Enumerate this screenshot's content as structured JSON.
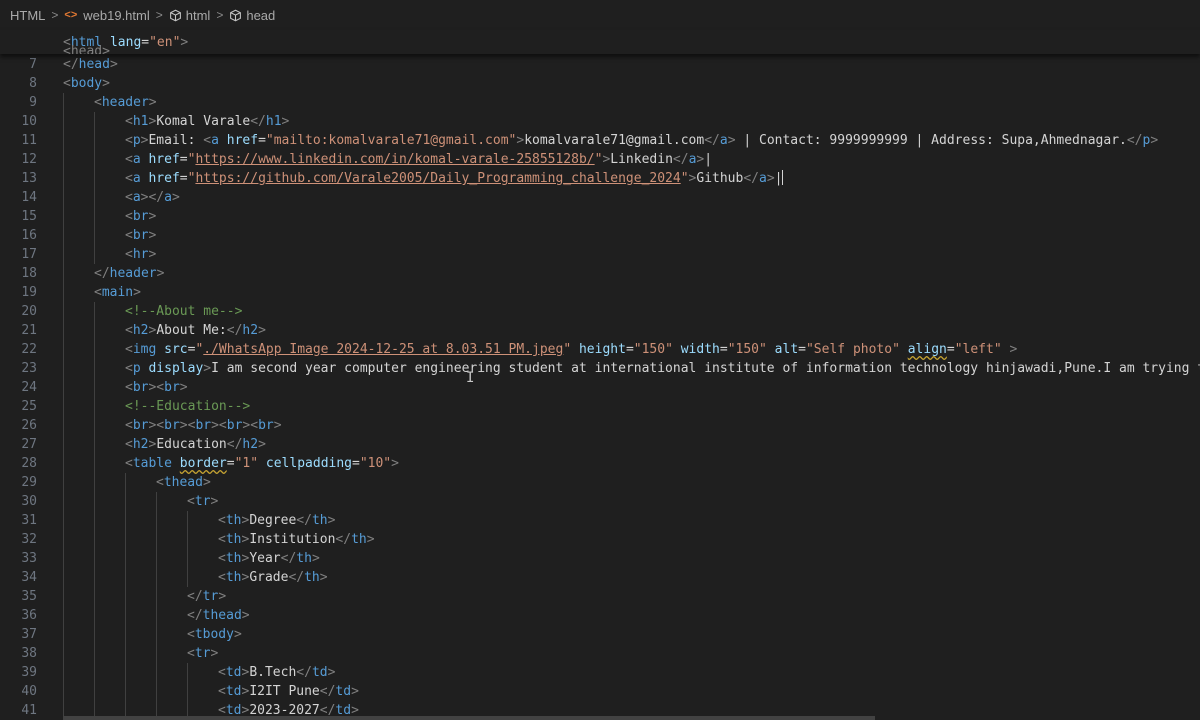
{
  "breadcrumb": {
    "root": "HTML",
    "file": "web19.html",
    "file_icon": "<>",
    "node1": "html",
    "node2": "head",
    "separator": ">"
  },
  "sticky": {
    "line_number": "2",
    "code": [
      {
        "t": "pun",
        "v": "<"
      },
      {
        "t": "tag",
        "v": "html"
      },
      {
        "t": "txt",
        "v": " "
      },
      {
        "t": "attr",
        "v": "lang"
      },
      {
        "t": "txt",
        "v": "="
      },
      {
        "t": "str",
        "v": "\"en\""
      },
      {
        "t": "pun",
        "v": ">"
      }
    ],
    "peek_line_number": "3",
    "peek_text": "<head>"
  },
  "lines": [
    {
      "n": "7",
      "i": 0,
      "c": [
        {
          "t": "pun",
          "v": "</"
        },
        {
          "t": "tag",
          "v": "head"
        },
        {
          "t": "pun",
          "v": ">"
        }
      ]
    },
    {
      "n": "8",
      "i": 0,
      "c": [
        {
          "t": "pun",
          "v": "<"
        },
        {
          "t": "tag",
          "v": "body"
        },
        {
          "t": "pun",
          "v": ">"
        }
      ]
    },
    {
      "n": "9",
      "i": 1,
      "c": [
        {
          "t": "pun",
          "v": "<"
        },
        {
          "t": "tag",
          "v": "header"
        },
        {
          "t": "pun",
          "v": ">"
        }
      ]
    },
    {
      "n": "10",
      "i": 2,
      "c": [
        {
          "t": "pun",
          "v": "<"
        },
        {
          "t": "tag",
          "v": "h1"
        },
        {
          "t": "pun",
          "v": ">"
        },
        {
          "t": "txt",
          "v": "Komal Varale"
        },
        {
          "t": "pun",
          "v": "</"
        },
        {
          "t": "tag",
          "v": "h1"
        },
        {
          "t": "pun",
          "v": ">"
        }
      ]
    },
    {
      "n": "11",
      "i": 2,
      "c": [
        {
          "t": "pun",
          "v": "<"
        },
        {
          "t": "tag",
          "v": "p"
        },
        {
          "t": "pun",
          "v": ">"
        },
        {
          "t": "txt",
          "v": "Email: "
        },
        {
          "t": "pun",
          "v": "<"
        },
        {
          "t": "tag",
          "v": "a"
        },
        {
          "t": "txt",
          "v": " "
        },
        {
          "t": "attr",
          "v": "href"
        },
        {
          "t": "txt",
          "v": "="
        },
        {
          "t": "str",
          "v": "\"mailto:komalvarale71@gmail.com\""
        },
        {
          "t": "pun",
          "v": ">"
        },
        {
          "t": "txt",
          "v": "komalvarale71@gmail.com"
        },
        {
          "t": "pun",
          "v": "</"
        },
        {
          "t": "tag",
          "v": "a"
        },
        {
          "t": "pun",
          "v": ">"
        },
        {
          "t": "txt",
          "v": " | Contact: 9999999999 | Address: Supa,Ahmednagar."
        },
        {
          "t": "pun",
          "v": "</"
        },
        {
          "t": "tag",
          "v": "p"
        },
        {
          "t": "pun",
          "v": ">"
        }
      ]
    },
    {
      "n": "12",
      "i": 2,
      "c": [
        {
          "t": "pun",
          "v": "<"
        },
        {
          "t": "tag",
          "v": "a"
        },
        {
          "t": "txt",
          "v": " "
        },
        {
          "t": "attr",
          "v": "href"
        },
        {
          "t": "txt",
          "v": "="
        },
        {
          "t": "str",
          "v": "\""
        },
        {
          "t": "url",
          "v": "https://www.linkedin.com/in/komal-varale-25855128b/"
        },
        {
          "t": "str",
          "v": "\""
        },
        {
          "t": "pun",
          "v": ">"
        },
        {
          "t": "txt",
          "v": "Linkedin"
        },
        {
          "t": "pun",
          "v": "</"
        },
        {
          "t": "tag",
          "v": "a"
        },
        {
          "t": "pun",
          "v": ">"
        },
        {
          "t": "txt",
          "v": "|"
        }
      ]
    },
    {
      "n": "13",
      "i": 2,
      "c": [
        {
          "t": "pun",
          "v": "<"
        },
        {
          "t": "tag",
          "v": "a"
        },
        {
          "t": "txt",
          "v": " "
        },
        {
          "t": "attr",
          "v": "href"
        },
        {
          "t": "txt",
          "v": "="
        },
        {
          "t": "str",
          "v": "\""
        },
        {
          "t": "url",
          "v": "https://github.com/Varale2005/Daily_Programming_challenge_2024"
        },
        {
          "t": "str",
          "v": "\""
        },
        {
          "t": "pun",
          "v": ">"
        },
        {
          "t": "txt",
          "v": "Github"
        },
        {
          "t": "pun",
          "v": "</"
        },
        {
          "t": "tag",
          "v": "a"
        },
        {
          "t": "pun",
          "v": ">"
        },
        {
          "t": "txt",
          "v": "|"
        }
      ],
      "cursor": true
    },
    {
      "n": "14",
      "i": 2,
      "c": [
        {
          "t": "pun",
          "v": "<"
        },
        {
          "t": "tag",
          "v": "a"
        },
        {
          "t": "pun",
          "v": "></"
        },
        {
          "t": "tag",
          "v": "a"
        },
        {
          "t": "pun",
          "v": ">"
        }
      ]
    },
    {
      "n": "15",
      "i": 2,
      "c": [
        {
          "t": "pun",
          "v": "<"
        },
        {
          "t": "tag",
          "v": "br"
        },
        {
          "t": "pun",
          "v": ">"
        }
      ]
    },
    {
      "n": "16",
      "i": 2,
      "c": [
        {
          "t": "pun",
          "v": "<"
        },
        {
          "t": "tag",
          "v": "br"
        },
        {
          "t": "pun",
          "v": ">"
        }
      ]
    },
    {
      "n": "17",
      "i": 2,
      "c": [
        {
          "t": "pun",
          "v": "<"
        },
        {
          "t": "tag",
          "v": "hr"
        },
        {
          "t": "pun",
          "v": ">"
        }
      ]
    },
    {
      "n": "18",
      "i": 1,
      "c": [
        {
          "t": "pun",
          "v": "</"
        },
        {
          "t": "tag",
          "v": "header"
        },
        {
          "t": "pun",
          "v": ">"
        }
      ]
    },
    {
      "n": "19",
      "i": 1,
      "c": [
        {
          "t": "pun",
          "v": "<"
        },
        {
          "t": "tag",
          "v": "main"
        },
        {
          "t": "pun",
          "v": ">"
        }
      ]
    },
    {
      "n": "20",
      "i": 2,
      "c": [
        {
          "t": "cmt",
          "v": "<!--About me-->"
        }
      ]
    },
    {
      "n": "21",
      "i": 2,
      "c": [
        {
          "t": "pun",
          "v": "<"
        },
        {
          "t": "tag",
          "v": "h2"
        },
        {
          "t": "pun",
          "v": ">"
        },
        {
          "t": "txt",
          "v": "About Me:"
        },
        {
          "t": "pun",
          "v": "</"
        },
        {
          "t": "tag",
          "v": "h2"
        },
        {
          "t": "pun",
          "v": ">"
        }
      ]
    },
    {
      "n": "22",
      "i": 2,
      "c": [
        {
          "t": "pun",
          "v": "<"
        },
        {
          "t": "tag",
          "v": "img"
        },
        {
          "t": "txt",
          "v": " "
        },
        {
          "t": "attr",
          "v": "src"
        },
        {
          "t": "txt",
          "v": "="
        },
        {
          "t": "str",
          "v": "\""
        },
        {
          "t": "url",
          "v": "./WhatsApp Image 2024-12-25 at 8.03.51 PM.jpeg"
        },
        {
          "t": "str",
          "v": "\""
        },
        {
          "t": "txt",
          "v": " "
        },
        {
          "t": "attr",
          "v": "height"
        },
        {
          "t": "txt",
          "v": "="
        },
        {
          "t": "str",
          "v": "\"150\""
        },
        {
          "t": "txt",
          "v": " "
        },
        {
          "t": "attr",
          "v": "width"
        },
        {
          "t": "txt",
          "v": "="
        },
        {
          "t": "str",
          "v": "\"150\""
        },
        {
          "t": "txt",
          "v": " "
        },
        {
          "t": "attr",
          "v": "alt"
        },
        {
          "t": "txt",
          "v": "="
        },
        {
          "t": "str",
          "v": "\"Self photo\""
        },
        {
          "t": "txt",
          "v": " "
        },
        {
          "t": "attr warn",
          "v": "align"
        },
        {
          "t": "txt",
          "v": "="
        },
        {
          "t": "str",
          "v": "\"left\""
        },
        {
          "t": "txt",
          "v": " "
        },
        {
          "t": "pun",
          "v": ">"
        }
      ]
    },
    {
      "n": "23",
      "i": 2,
      "c": [
        {
          "t": "pun",
          "v": "<"
        },
        {
          "t": "tag",
          "v": "p"
        },
        {
          "t": "txt",
          "v": " "
        },
        {
          "t": "attr",
          "v": "display"
        },
        {
          "t": "pun",
          "v": ">"
        },
        {
          "t": "txt",
          "v": "I am second year computer engineering student at international institute of information technology hinjawadi,Pune.I am trying to"
        }
      ]
    },
    {
      "n": "24",
      "i": 2,
      "c": [
        {
          "t": "pun",
          "v": "<"
        },
        {
          "t": "tag",
          "v": "br"
        },
        {
          "t": "pun",
          "v": "><"
        },
        {
          "t": "tag",
          "v": "br"
        },
        {
          "t": "pun",
          "v": ">"
        }
      ]
    },
    {
      "n": "25",
      "i": 2,
      "c": [
        {
          "t": "cmt",
          "v": "<!--Education-->"
        }
      ]
    },
    {
      "n": "26",
      "i": 2,
      "c": [
        {
          "t": "pun",
          "v": "<"
        },
        {
          "t": "tag",
          "v": "br"
        },
        {
          "t": "pun",
          "v": "><"
        },
        {
          "t": "tag",
          "v": "br"
        },
        {
          "t": "pun",
          "v": "><"
        },
        {
          "t": "tag",
          "v": "br"
        },
        {
          "t": "pun",
          "v": "><"
        },
        {
          "t": "tag",
          "v": "br"
        },
        {
          "t": "pun",
          "v": "><"
        },
        {
          "t": "tag",
          "v": "br"
        },
        {
          "t": "pun",
          "v": ">"
        }
      ]
    },
    {
      "n": "27",
      "i": 2,
      "c": [
        {
          "t": "pun",
          "v": "<"
        },
        {
          "t": "tag",
          "v": "h2"
        },
        {
          "t": "pun",
          "v": ">"
        },
        {
          "t": "txt",
          "v": "Education"
        },
        {
          "t": "pun",
          "v": "</"
        },
        {
          "t": "tag",
          "v": "h2"
        },
        {
          "t": "pun",
          "v": ">"
        }
      ]
    },
    {
      "n": "28",
      "i": 2,
      "c": [
        {
          "t": "pun",
          "v": "<"
        },
        {
          "t": "tag",
          "v": "table"
        },
        {
          "t": "txt",
          "v": " "
        },
        {
          "t": "attr warn",
          "v": "border"
        },
        {
          "t": "txt",
          "v": "="
        },
        {
          "t": "str",
          "v": "\"1\""
        },
        {
          "t": "txt",
          "v": " "
        },
        {
          "t": "attr",
          "v": "cellpadding"
        },
        {
          "t": "txt",
          "v": "="
        },
        {
          "t": "str",
          "v": "\"10\""
        },
        {
          "t": "pun",
          "v": ">"
        }
      ]
    },
    {
      "n": "29",
      "i": 3,
      "c": [
        {
          "t": "pun",
          "v": "<"
        },
        {
          "t": "tag",
          "v": "thead"
        },
        {
          "t": "pun",
          "v": ">"
        }
      ]
    },
    {
      "n": "30",
      "i": 4,
      "c": [
        {
          "t": "pun",
          "v": "<"
        },
        {
          "t": "tag",
          "v": "tr"
        },
        {
          "t": "pun",
          "v": ">"
        }
      ]
    },
    {
      "n": "31",
      "i": 5,
      "c": [
        {
          "t": "pun",
          "v": "<"
        },
        {
          "t": "tag",
          "v": "th"
        },
        {
          "t": "pun",
          "v": ">"
        },
        {
          "t": "txt",
          "v": "Degree"
        },
        {
          "t": "pun",
          "v": "</"
        },
        {
          "t": "tag",
          "v": "th"
        },
        {
          "t": "pun",
          "v": ">"
        }
      ]
    },
    {
      "n": "32",
      "i": 5,
      "c": [
        {
          "t": "pun",
          "v": "<"
        },
        {
          "t": "tag",
          "v": "th"
        },
        {
          "t": "pun",
          "v": ">"
        },
        {
          "t": "txt",
          "v": "Institution"
        },
        {
          "t": "pun",
          "v": "</"
        },
        {
          "t": "tag",
          "v": "th"
        },
        {
          "t": "pun",
          "v": ">"
        }
      ]
    },
    {
      "n": "33",
      "i": 5,
      "c": [
        {
          "t": "pun",
          "v": "<"
        },
        {
          "t": "tag",
          "v": "th"
        },
        {
          "t": "pun",
          "v": ">"
        },
        {
          "t": "txt",
          "v": "Year"
        },
        {
          "t": "pun",
          "v": "</"
        },
        {
          "t": "tag",
          "v": "th"
        },
        {
          "t": "pun",
          "v": ">"
        }
      ]
    },
    {
      "n": "34",
      "i": 5,
      "c": [
        {
          "t": "pun",
          "v": "<"
        },
        {
          "t": "tag",
          "v": "th"
        },
        {
          "t": "pun",
          "v": ">"
        },
        {
          "t": "txt",
          "v": "Grade"
        },
        {
          "t": "pun",
          "v": "</"
        },
        {
          "t": "tag",
          "v": "th"
        },
        {
          "t": "pun",
          "v": ">"
        }
      ]
    },
    {
      "n": "35",
      "i": 4,
      "c": [
        {
          "t": "pun",
          "v": "</"
        },
        {
          "t": "tag",
          "v": "tr"
        },
        {
          "t": "pun",
          "v": ">"
        }
      ]
    },
    {
      "n": "36",
      "i": 4,
      "c": [
        {
          "t": "pun",
          "v": "</"
        },
        {
          "t": "tag",
          "v": "thead"
        },
        {
          "t": "pun",
          "v": ">"
        }
      ]
    },
    {
      "n": "37",
      "i": 4,
      "c": [
        {
          "t": "pun",
          "v": "<"
        },
        {
          "t": "tag",
          "v": "tbody"
        },
        {
          "t": "pun",
          "v": ">"
        }
      ]
    },
    {
      "n": "38",
      "i": 4,
      "c": [
        {
          "t": "pun",
          "v": "<"
        },
        {
          "t": "tag",
          "v": "tr"
        },
        {
          "t": "pun",
          "v": ">"
        }
      ]
    },
    {
      "n": "39",
      "i": 5,
      "c": [
        {
          "t": "pun",
          "v": "<"
        },
        {
          "t": "tag",
          "v": "td"
        },
        {
          "t": "pun",
          "v": ">"
        },
        {
          "t": "txt",
          "v": "B.Tech"
        },
        {
          "t": "pun",
          "v": "</"
        },
        {
          "t": "tag",
          "v": "td"
        },
        {
          "t": "pun",
          "v": ">"
        }
      ]
    },
    {
      "n": "40",
      "i": 5,
      "c": [
        {
          "t": "pun",
          "v": "<"
        },
        {
          "t": "tag",
          "v": "td"
        },
        {
          "t": "pun",
          "v": ">"
        },
        {
          "t": "txt",
          "v": "I2IT Pune"
        },
        {
          "t": "pun",
          "v": "</"
        },
        {
          "t": "tag",
          "v": "td"
        },
        {
          "t": "pun",
          "v": ">"
        }
      ]
    },
    {
      "n": "41",
      "i": 5,
      "c": [
        {
          "t": "pun",
          "v": "<"
        },
        {
          "t": "tag",
          "v": "td"
        },
        {
          "t": "pun",
          "v": ">"
        },
        {
          "t": "txt",
          "v": "2023-2027"
        },
        {
          "t": "pun",
          "v": "</"
        },
        {
          "t": "tag",
          "v": "td"
        },
        {
          "t": "pun",
          "v": ">"
        }
      ]
    }
  ]
}
